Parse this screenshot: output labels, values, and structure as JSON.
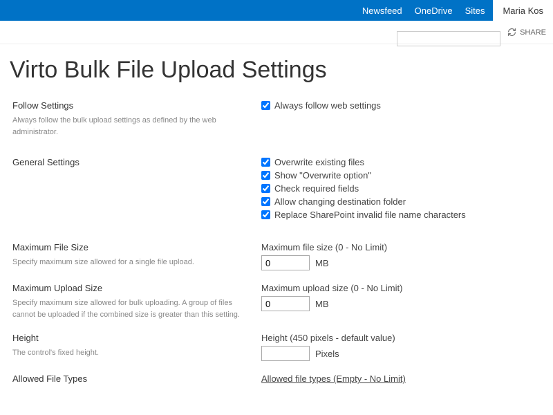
{
  "topbar": {
    "links": [
      "Newsfeed",
      "OneDrive",
      "Sites"
    ],
    "user": "Maria Kos"
  },
  "subbar": {
    "share": "SHARE"
  },
  "searchPlaceholder": "",
  "pageTitle": "Virto Bulk File Upload Settings",
  "sections": {
    "follow": {
      "title": "Follow Settings",
      "desc": "Always follow the bulk upload settings as defined by the web administrator.",
      "checkbox_label": "Always follow web settings",
      "checkbox_checked": true
    },
    "general": {
      "title": "General Settings",
      "options": [
        {
          "label": "Overwrite existing files",
          "checked": true
        },
        {
          "label": "Show \"Overwrite option\"",
          "checked": true
        },
        {
          "label": "Check required fields",
          "checked": true
        },
        {
          "label": "Allow changing destination folder",
          "checked": true
        },
        {
          "label": "Replace SharePoint invalid file name characters",
          "checked": true
        }
      ]
    },
    "maxFileSize": {
      "title": "Maximum File Size",
      "desc": "Specify maximum size allowed for a single file upload.",
      "field_label": "Maximum file size (0 - No Limit)",
      "value": "0",
      "unit": "MB"
    },
    "maxUploadSize": {
      "title": "Maximum Upload Size",
      "desc": "Specify maximum size allowed for bulk uploading. A group of files cannot be uploaded if the combined size is greater than this setting.",
      "field_label": "Maximum upload size (0 - No Limit)",
      "value": "0",
      "unit": "MB"
    },
    "height": {
      "title": "Height",
      "desc": "The control's fixed height.",
      "field_label": "Height (450 pixels - default value)",
      "value": "",
      "unit": "Pixels"
    },
    "allowedTypes": {
      "title": "Allowed File Types",
      "field_label": "Allowed file types (Empty - No Limit)"
    }
  }
}
